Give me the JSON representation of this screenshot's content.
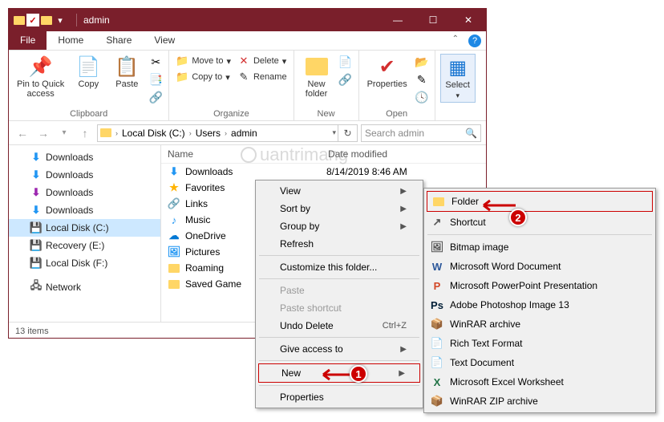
{
  "window": {
    "title": "admin",
    "minimize": "—",
    "maximize": "☐",
    "close": "✕"
  },
  "tabs": {
    "file": "File",
    "home": "Home",
    "share": "Share",
    "view": "View"
  },
  "ribbon": {
    "clipboard": {
      "label": "Clipboard",
      "pin": "Pin to Quick\naccess",
      "copy": "Copy",
      "paste": "Paste"
    },
    "organize": {
      "label": "Organize",
      "moveto": "Move to",
      "copyto": "Copy to",
      "delete": "Delete",
      "rename": "Rename"
    },
    "new": {
      "label": "New",
      "newfolder": "New\nfolder"
    },
    "open": {
      "label": "Open",
      "properties": "Properties"
    },
    "select": {
      "label": "Select",
      "select": "Select"
    }
  },
  "address": {
    "segs": [
      "Local Disk (C:)",
      "Users",
      "admin"
    ],
    "search_placeholder": "Search admin"
  },
  "tree": [
    {
      "icon": "download",
      "label": "Downloads",
      "color": "#2196f3"
    },
    {
      "icon": "download",
      "label": "Downloads",
      "color": "#2196f3"
    },
    {
      "icon": "download",
      "label": "Downloads",
      "color": "#9c27b0"
    },
    {
      "icon": "download",
      "label": "Downloads",
      "color": "#2196f3"
    },
    {
      "icon": "disk",
      "label": "Local Disk (C:)",
      "selected": true
    },
    {
      "icon": "disk",
      "label": "Recovery (E:)"
    },
    {
      "icon": "disk",
      "label": "Local Disk (F:)"
    },
    {
      "sep": true
    },
    {
      "icon": "network",
      "label": "Network"
    }
  ],
  "columns": {
    "name": "Name",
    "date": "Date modified"
  },
  "files": [
    {
      "icon": "download",
      "label": "Downloads",
      "date": "8/14/2019 8:46 AM",
      "color": "#2196f3"
    },
    {
      "icon": "star",
      "label": "Favorites",
      "color": "#ffb300"
    },
    {
      "icon": "link",
      "label": "Links",
      "color": "#2196f3"
    },
    {
      "icon": "music",
      "label": "Music",
      "color": "#2196f3"
    },
    {
      "icon": "cloud",
      "label": "OneDrive",
      "color": "#0078d4"
    },
    {
      "icon": "pictures",
      "label": "Pictures",
      "color": "#2196f3"
    },
    {
      "icon": "folder",
      "label": "Roaming"
    },
    {
      "icon": "folder",
      "label": "Saved Game"
    }
  ],
  "status": "13 items",
  "ctx1": [
    {
      "label": "View",
      "arrow": true
    },
    {
      "label": "Sort by",
      "arrow": true
    },
    {
      "label": "Group by",
      "arrow": true
    },
    {
      "label": "Refresh"
    },
    {
      "sep": true
    },
    {
      "label": "Customize this folder..."
    },
    {
      "sep": true
    },
    {
      "label": "Paste",
      "disabled": true
    },
    {
      "label": "Paste shortcut",
      "disabled": true
    },
    {
      "label": "Undo Delete",
      "shortcut": "Ctrl+Z"
    },
    {
      "sep": true
    },
    {
      "label": "Give access to",
      "arrow": true
    },
    {
      "sep": true
    },
    {
      "label": "New",
      "arrow": true,
      "boxed": true
    },
    {
      "sep": true
    },
    {
      "label": "Properties"
    }
  ],
  "ctx2": [
    {
      "icon": "folder",
      "label": "Folder",
      "boxed": true
    },
    {
      "icon": "shortcut",
      "label": "Shortcut"
    },
    {
      "sep": true
    },
    {
      "icon": "bmp",
      "label": "Bitmap image"
    },
    {
      "icon": "word",
      "label": "Microsoft Word Document"
    },
    {
      "icon": "ppt",
      "label": "Microsoft PowerPoint Presentation"
    },
    {
      "icon": "psd",
      "label": "Adobe Photoshop Image 13"
    },
    {
      "icon": "rar",
      "label": "WinRAR archive"
    },
    {
      "icon": "rtf",
      "label": "Rich Text Format"
    },
    {
      "icon": "txt",
      "label": "Text Document"
    },
    {
      "icon": "xls",
      "label": "Microsoft Excel Worksheet"
    },
    {
      "icon": "zip",
      "label": "WinRAR ZIP archive"
    }
  ],
  "callouts": {
    "one": "1",
    "two": "2"
  },
  "watermark": "uantrimang"
}
